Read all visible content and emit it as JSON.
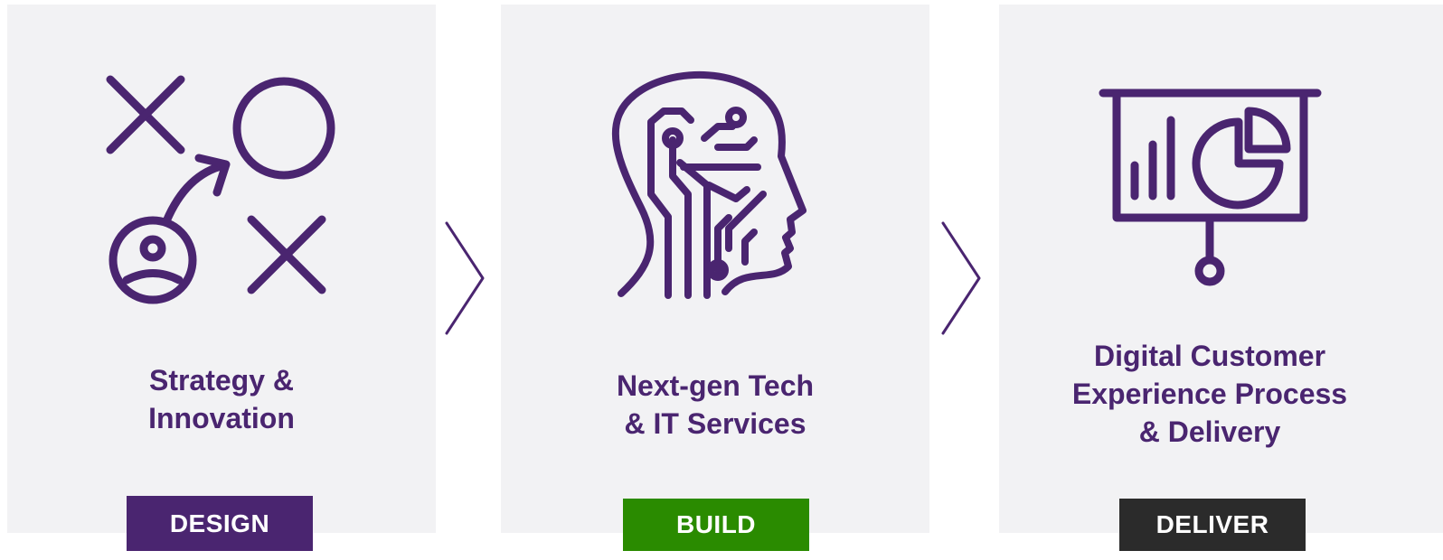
{
  "colors": {
    "icon": "#4a2570",
    "card_bg": "#f2f2f4",
    "design_badge": "#4a2570",
    "build_badge": "#2a8b00",
    "deliver_badge": "#2b2b2b"
  },
  "stages": [
    {
      "icon": "strategy-icon",
      "title_lines": [
        "Strategy &",
        "Innovation"
      ],
      "badge": "DESIGN"
    },
    {
      "icon": "ai-head-icon",
      "title_lines": [
        "Next-gen Tech",
        "& IT Services"
      ],
      "badge": "BUILD"
    },
    {
      "icon": "presentation-board-icon",
      "title_lines": [
        "Digital Customer",
        "Experience Process",
        "& Delivery"
      ],
      "badge": "DELIVER"
    }
  ],
  "connectors": [
    "chevron-right-icon",
    "chevron-right-icon"
  ]
}
